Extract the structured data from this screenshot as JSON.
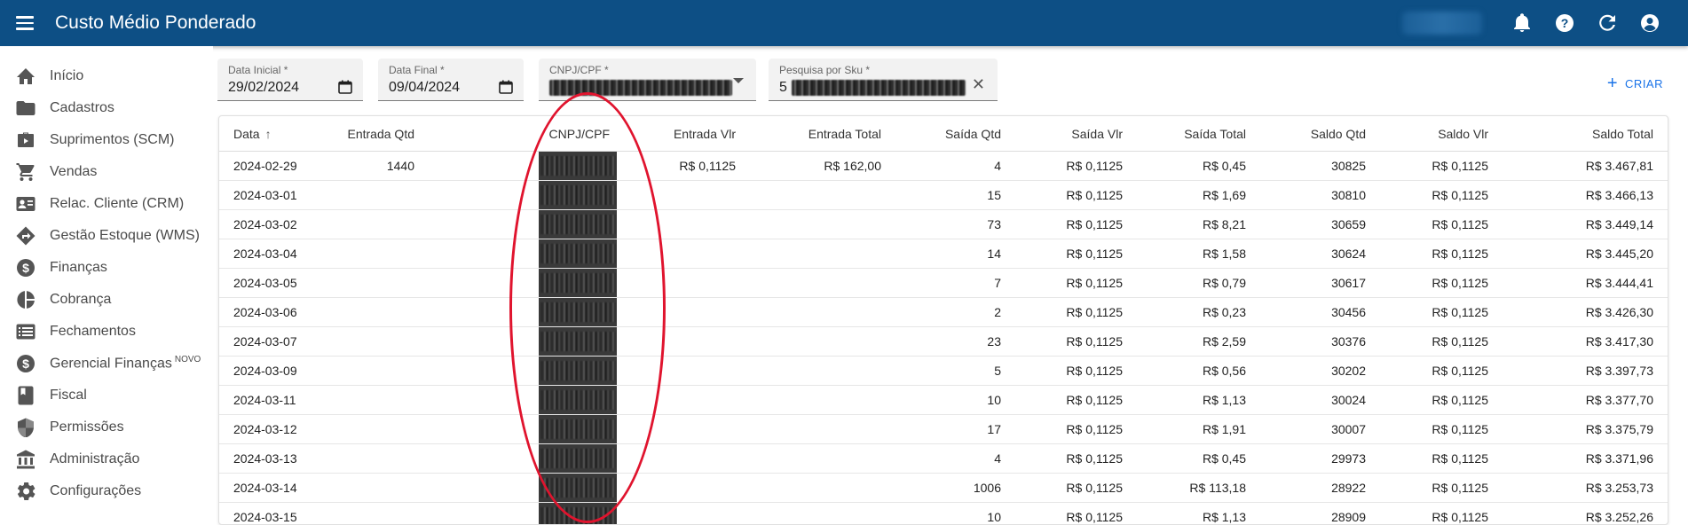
{
  "app": {
    "title": "Custo Médio Ponderado"
  },
  "topbar": {
    "icons": [
      "bell-icon",
      "help-icon",
      "refresh-icon",
      "account-icon"
    ]
  },
  "sidebar": {
    "items": [
      {
        "label": "Início",
        "icon": "home-icon"
      },
      {
        "label": "Cadastros",
        "icon": "folder-icon"
      },
      {
        "label": "Suprimentos (SCM)",
        "icon": "briefcase-icon"
      },
      {
        "label": "Vendas",
        "icon": "cart-icon"
      },
      {
        "label": "Relac. Cliente (CRM)",
        "icon": "contact-card-icon"
      },
      {
        "label": "Gestão Estoque (WMS)",
        "icon": "directions-icon"
      },
      {
        "label": "Finanças",
        "icon": "dollar-circle-icon"
      },
      {
        "label": "Cobrança",
        "icon": "pie-icon"
      },
      {
        "label": "Fechamentos",
        "icon": "list-icon"
      },
      {
        "label": "Gerencial Finanças",
        "badge": "NOVO",
        "icon": "dollar-circle-icon"
      },
      {
        "label": "Fiscal",
        "icon": "book-icon"
      },
      {
        "label": "Permissões",
        "icon": "shield-icon"
      },
      {
        "label": "Administração",
        "icon": "bank-icon"
      },
      {
        "label": "Configurações",
        "icon": "gear-icon"
      }
    ]
  },
  "filters": {
    "data_inicial": {
      "label": "Data Inicial *",
      "value": "29/02/2024"
    },
    "data_final": {
      "label": "Data Final *",
      "value": "09/04/2024"
    },
    "cnpj": {
      "label": "CNPJ/CPF *"
    },
    "sku": {
      "label": "Pesquisa por Sku *",
      "value_prefix": "5"
    },
    "create_label": "CRIAR"
  },
  "table": {
    "headers": [
      "Data",
      "Entrada Qtd",
      "CNPJ/CPF",
      "Entrada Vlr",
      "Entrada Total",
      "Saída Qtd",
      "Saída Vlr",
      "Saída Total",
      "Saldo Qtd",
      "Saldo Vlr",
      "Saldo Total"
    ],
    "rows": [
      {
        "data": "2024-02-29",
        "entrada_qtd": "1440",
        "entrada_vlr": "R$ 0,1125",
        "entrada_total": "R$ 162,00",
        "saida_qtd": "4",
        "saida_vlr": "R$ 0,1125",
        "saida_total": "R$ 0,45",
        "saldo_qtd": "30825",
        "saldo_vlr": "R$ 0,1125",
        "saldo_total": "R$ 3.467,81"
      },
      {
        "data": "2024-03-01",
        "entrada_qtd": "",
        "entrada_vlr": "",
        "entrada_total": "",
        "saida_qtd": "15",
        "saida_vlr": "R$ 0,1125",
        "saida_total": "R$ 1,69",
        "saldo_qtd": "30810",
        "saldo_vlr": "R$ 0,1125",
        "saldo_total": "R$ 3.466,13"
      },
      {
        "data": "2024-03-02",
        "entrada_qtd": "",
        "entrada_vlr": "",
        "entrada_total": "",
        "saida_qtd": "73",
        "saida_vlr": "R$ 0,1125",
        "saida_total": "R$ 8,21",
        "saldo_qtd": "30659",
        "saldo_vlr": "R$ 0,1125",
        "saldo_total": "R$ 3.449,14"
      },
      {
        "data": "2024-03-04",
        "entrada_qtd": "",
        "entrada_vlr": "",
        "entrada_total": "",
        "saida_qtd": "14",
        "saida_vlr": "R$ 0,1125",
        "saida_total": "R$ 1,58",
        "saldo_qtd": "30624",
        "saldo_vlr": "R$ 0,1125",
        "saldo_total": "R$ 3.445,20"
      },
      {
        "data": "2024-03-05",
        "entrada_qtd": "",
        "entrada_vlr": "",
        "entrada_total": "",
        "saida_qtd": "7",
        "saida_vlr": "R$ 0,1125",
        "saida_total": "R$ 0,79",
        "saldo_qtd": "30617",
        "saldo_vlr": "R$ 0,1125",
        "saldo_total": "R$ 3.444,41"
      },
      {
        "data": "2024-03-06",
        "entrada_qtd": "",
        "entrada_vlr": "",
        "entrada_total": "",
        "saida_qtd": "2",
        "saida_vlr": "R$ 0,1125",
        "saida_total": "R$ 0,23",
        "saldo_qtd": "30456",
        "saldo_vlr": "R$ 0,1125",
        "saldo_total": "R$ 3.426,30"
      },
      {
        "data": "2024-03-07",
        "entrada_qtd": "",
        "entrada_vlr": "",
        "entrada_total": "",
        "saida_qtd": "23",
        "saida_vlr": "R$ 0,1125",
        "saida_total": "R$ 2,59",
        "saldo_qtd": "30376",
        "saldo_vlr": "R$ 0,1125",
        "saldo_total": "R$ 3.417,30"
      },
      {
        "data": "2024-03-09",
        "entrada_qtd": "",
        "entrada_vlr": "",
        "entrada_total": "",
        "saida_qtd": "5",
        "saida_vlr": "R$ 0,1125",
        "saida_total": "R$ 0,56",
        "saldo_qtd": "30202",
        "saldo_vlr": "R$ 0,1125",
        "saldo_total": "R$ 3.397,73"
      },
      {
        "data": "2024-03-11",
        "entrada_qtd": "",
        "entrada_vlr": "",
        "entrada_total": "",
        "saida_qtd": "10",
        "saida_vlr": "R$ 0,1125",
        "saida_total": "R$ 1,13",
        "saldo_qtd": "30024",
        "saldo_vlr": "R$ 0,1125",
        "saldo_total": "R$ 3.377,70"
      },
      {
        "data": "2024-03-12",
        "entrada_qtd": "",
        "entrada_vlr": "",
        "entrada_total": "",
        "saida_qtd": "17",
        "saida_vlr": "R$ 0,1125",
        "saida_total": "R$ 1,91",
        "saldo_qtd": "30007",
        "saldo_vlr": "R$ 0,1125",
        "saldo_total": "R$ 3.375,79"
      },
      {
        "data": "2024-03-13",
        "entrada_qtd": "",
        "entrada_vlr": "",
        "entrada_total": "",
        "saida_qtd": "4",
        "saida_vlr": "R$ 0,1125",
        "saida_total": "R$ 0,45",
        "saldo_qtd": "29973",
        "saldo_vlr": "R$ 0,1125",
        "saldo_total": "R$ 3.371,96"
      },
      {
        "data": "2024-03-14",
        "entrada_qtd": "",
        "entrada_vlr": "",
        "entrada_total": "",
        "saida_qtd": "1006",
        "saida_vlr": "R$ 0,1125",
        "saida_total": "R$ 113,18",
        "saldo_qtd": "28922",
        "saldo_vlr": "R$ 0,1125",
        "saldo_total": "R$ 3.253,73"
      },
      {
        "data": "2024-03-15",
        "entrada_qtd": "",
        "entrada_vlr": "",
        "entrada_total": "",
        "saida_qtd": "10",
        "saida_vlr": "R$ 0,1125",
        "saida_total": "R$ 1,13",
        "saldo_qtd": "28909",
        "saldo_vlr": "R$ 0,1125",
        "saldo_total": "R$ 3.252,26"
      }
    ]
  },
  "colors": {
    "appbar": "#0d4f85",
    "accent": "#1a73e8",
    "annotation": "#e0142e"
  }
}
